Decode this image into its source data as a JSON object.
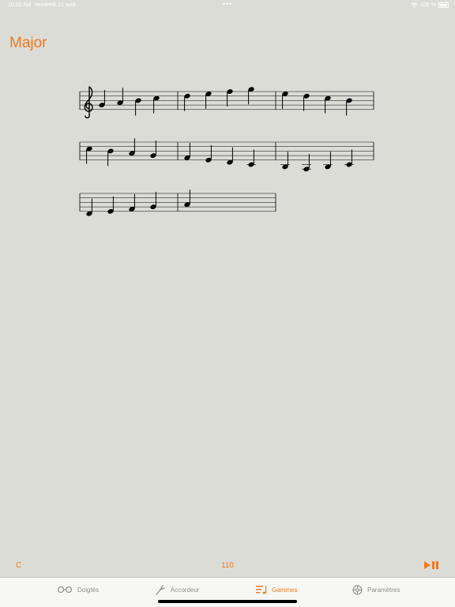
{
  "status_bar": {
    "time": "10:02 AM",
    "date": "Vendredi 21 avril",
    "battery": "100 %",
    "wifi_icon": "wifi-icon"
  },
  "page": {
    "title": "Major"
  },
  "score": {
    "clef": "treble-clef-icon",
    "rows": [
      {
        "measures": [
          [
            "G4",
            "A4",
            "B4",
            "C5"
          ],
          [
            "D5",
            "E5",
            "F5",
            "G5"
          ],
          [
            "E5",
            "D5",
            "C5",
            "B4"
          ]
        ]
      },
      {
        "measures": [
          [
            "C5",
            "B4",
            "A4",
            "G4"
          ],
          [
            "F4",
            "E4",
            "D4",
            "C4"
          ],
          [
            "B3",
            "A3",
            "B3",
            "C4"
          ]
        ]
      },
      {
        "measures": [
          [
            "D4",
            "E4",
            "F4",
            "G4"
          ],
          [
            "A4"
          ]
        ]
      }
    ]
  },
  "controls": {
    "key": "C",
    "tempo": "110",
    "play_pause_icon": "play-pause-icon"
  },
  "tab_bar": {
    "tabs": [
      {
        "label": "Doigtés",
        "icon": "glasses-icon",
        "active": false
      },
      {
        "label": "Accordeur",
        "icon": "tuning-fork-icon",
        "active": false
      },
      {
        "label": "Gammes",
        "icon": "scales-icon",
        "active": true
      },
      {
        "label": "Paramètres",
        "icon": "gear-icon",
        "active": false
      }
    ],
    "accent": "#f07a1e",
    "inactive": "#8e8e8e"
  }
}
